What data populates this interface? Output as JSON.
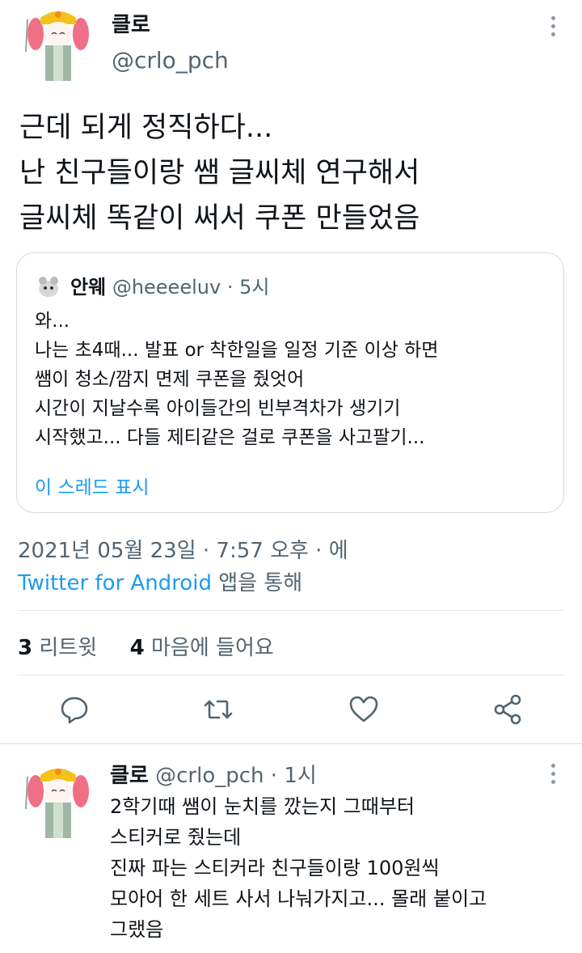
{
  "main_tweet": {
    "name": "클로",
    "handle": "@crlo_pch",
    "lines": [
      "근데 되게 정직하다...",
      "난 친구들이랑 쌤 글씨체 연구해서",
      "글씨체 똑같이 써서 쿠폰 만들었음"
    ]
  },
  "quote": {
    "name": "안웨",
    "handle": "@heeeeluv",
    "sep": "·",
    "time": "5시",
    "lines": [
      "와...",
      "나는 초4때... 발표 or 착한일을 일정 기준 이상 하면",
      "쌤이 청소/깜지 면제 쿠폰을 줬엇어",
      "시간이 지날수록 아이들간의 빈부격차가 생기기",
      "시작했고... 다들 제티같은 걸로 쿠폰을 사고팔기..."
    ],
    "show_thread": "이 스레드 표시"
  },
  "meta": {
    "datetime": "2021년 05월 23일 · 7:57 오후 · 에",
    "source_app": "Twitter for Android",
    "source_suffix": " 앱을 통해"
  },
  "stats": {
    "retweets_count": "3",
    "retweets_label": " 리트윗",
    "likes_count": "4",
    "likes_label": " 마음에 들어요"
  },
  "actions": [
    "reply-icon",
    "retweet-icon",
    "like-icon",
    "share-icon"
  ],
  "reply_tweet": {
    "name": "클로",
    "handle": "@crlo_pch",
    "sep": "·",
    "time": "1시",
    "lines": [
      "2학기때 쌤이 눈치를 깠는지 그때부터",
      "스티커로 줬는데",
      "진짜 파는 스티커라 친구들이랑 100원씩",
      "모아어 한 세트 사서 나눠가지고... 몰래 붙이고",
      "그랬음"
    ]
  },
  "colors": {
    "accent": "#1d9bf0",
    "secondary_text": "#536471",
    "border": "#cfd9de"
  }
}
